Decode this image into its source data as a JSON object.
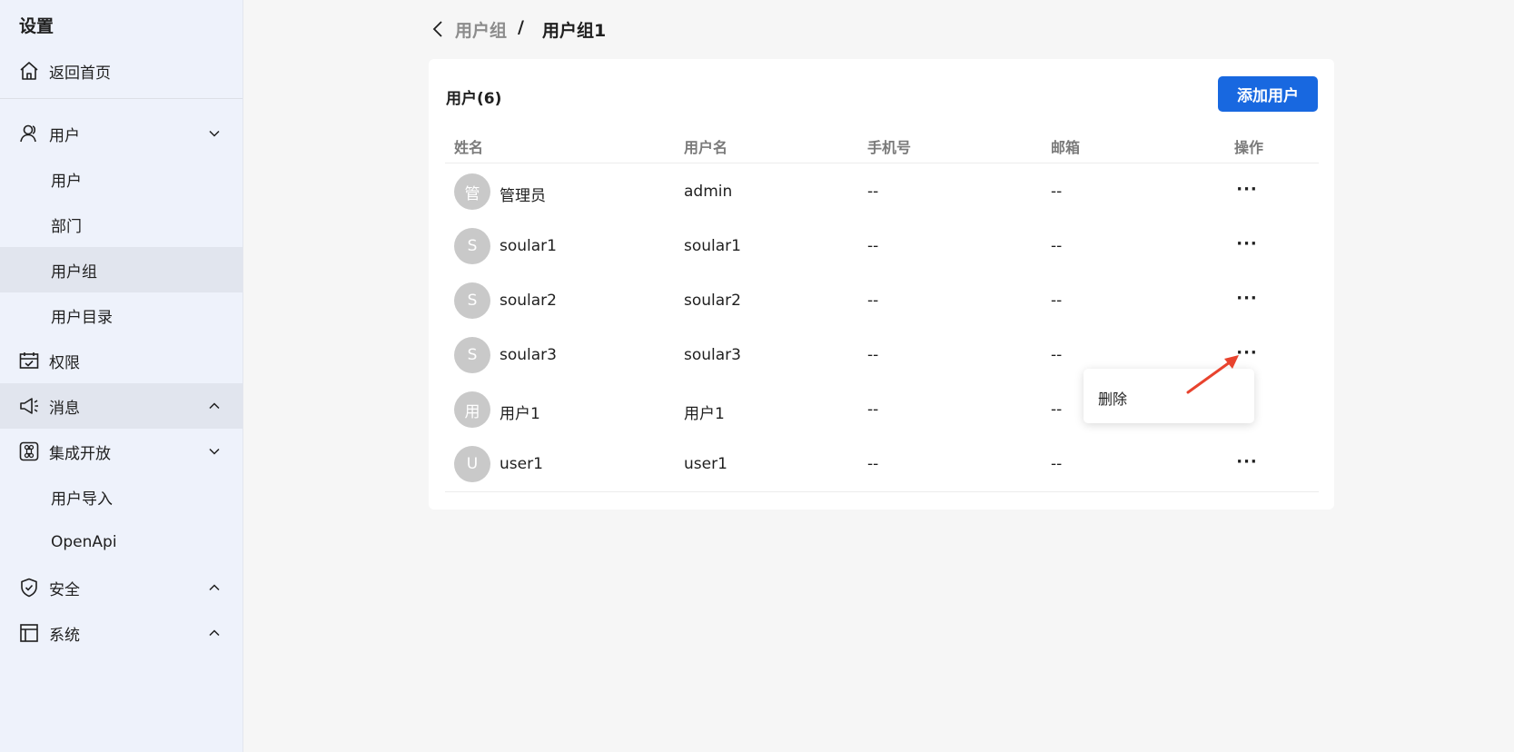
{
  "sidebar": {
    "title": "设置",
    "home": "返回首页",
    "items": [
      {
        "label": "用户"
      },
      {
        "label": "用户"
      },
      {
        "label": "部门"
      },
      {
        "label": "用户组"
      },
      {
        "label": "用户目录"
      },
      {
        "label": "权限"
      },
      {
        "label": "消息"
      },
      {
        "label": "集成开放"
      },
      {
        "label": "用户导入"
      },
      {
        "label": "OpenApi"
      },
      {
        "label": "安全"
      },
      {
        "label": "系统"
      }
    ]
  },
  "breadcrumb": {
    "parent": "用户组",
    "separator": "/",
    "current": "用户组1"
  },
  "card": {
    "title": "用户(6)",
    "add_button": "添加用户",
    "columns": [
      "姓名",
      "用户名",
      "手机号",
      "邮箱",
      "操作"
    ],
    "rows": [
      {
        "avatar": "管",
        "name": "管理员",
        "username": "admin",
        "phone": "--",
        "email": "--",
        "action": "···"
      },
      {
        "avatar": "S",
        "name": "soular1",
        "username": "soular1",
        "phone": "--",
        "email": "--",
        "action": "···"
      },
      {
        "avatar": "S",
        "name": "soular2",
        "username": "soular2",
        "phone": "--",
        "email": "--",
        "action": "···"
      },
      {
        "avatar": "S",
        "name": "soular3",
        "username": "soular3",
        "phone": "--",
        "email": "--",
        "action": "···"
      },
      {
        "avatar": "用",
        "name": "用户1",
        "username": "用户1",
        "phone": "--",
        "email": "--",
        "action": ""
      },
      {
        "avatar": "U",
        "name": "user1",
        "username": "user1",
        "phone": "--",
        "email": "--",
        "action": "···"
      }
    ]
  },
  "dropdown": {
    "delete_label": "删除"
  },
  "colors": {
    "primary": "#1868e0",
    "sidebar_bg": "#eef2fb",
    "avatar_bg": "#c9c9c9",
    "annotation_arrow": "#e8432e"
  }
}
